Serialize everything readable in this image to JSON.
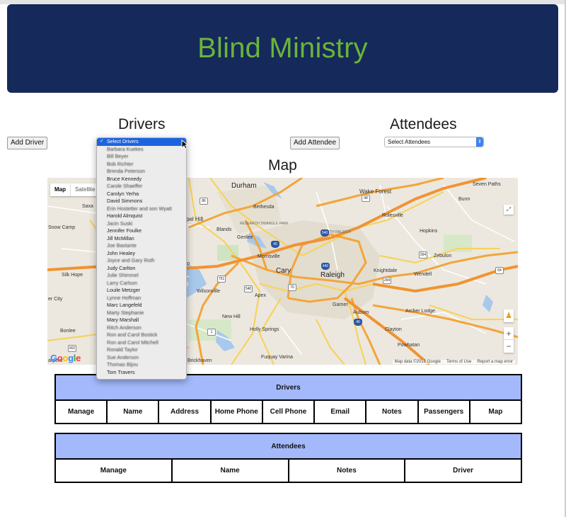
{
  "header": {
    "title": "Blind Ministry"
  },
  "drivers": {
    "heading": "Drivers",
    "add_button": "Add Driver",
    "select": {
      "selected": "Select Drivers",
      "options": [
        "Barbara Kuekes",
        "Bill Beyer",
        "Bob Richter",
        "Brenda Peterson",
        "Bruce Kennedy",
        "Carole Shaeffer",
        "Carolyn Yerha",
        "David Simmons",
        "Erin Hostetter and son Wyatt",
        "Harold Almquist",
        "Jacin Suski",
        "Jennifer Foulke",
        "Jill McMillan",
        "Joe Bastante",
        "John Healey",
        "Joyce and Gary Roth",
        "Judy Carlton",
        "Julie Shimmel",
        "Larry Carlson",
        "Louile Metzger",
        "Lynne Hoffman",
        "Marc Langefeld",
        "Marty Stephanie",
        "Mary Marshall",
        "Ritch Anderson",
        "Ron and Carol Bostick",
        "Ron and Carol Mitchell",
        "Ronald Taylor",
        "Sue Anderson",
        "Thomas Bijou",
        "Tom Travers"
      ]
    }
  },
  "attendees": {
    "heading": "Attendees",
    "add_button": "Add Attendee",
    "select": {
      "selected": "Select Attendees"
    }
  },
  "map": {
    "heading": "Map",
    "type_map": "Map",
    "type_satellite": "Satellite",
    "logo": "Google",
    "footer": {
      "data": "Map data ©2016 Google",
      "terms": "Terms of Use",
      "report": "Report a map error"
    },
    "zoom_in": "+",
    "zoom_out": "−",
    "places": {
      "durham": "Durham",
      "wake_forest": "Wake Forest",
      "seven_paths": "Seven Paths",
      "bunn": "Bunn",
      "bethesda": "Bethesda",
      "rolesville": "Rolesville",
      "snow_camp": "Snow Camp",
      "chapel_hill": "pel Hill",
      "blands": "Blands",
      "rtp": "RESEARCH TRIANGLE PARK",
      "north_raleigh": "NORTH RALEIGH",
      "hopkins": "Hopkins",
      "genlee": "Genlee",
      "morrisville": "Morrisville",
      "zebulon": "Zebulon",
      "cary": "Cary",
      "raleigh": "Raleigh",
      "knightdale": "Knightdale",
      "wendell": "Wendell",
      "silk_hope": "Silk Hope",
      "wilsonville": "Wilsonville",
      "apex": "Apex",
      "er_city": "er City",
      "archer_lodge": "Archer Lodge",
      "garner": "Garner",
      "new_hill": "New Hill",
      "auburn": "Auburn",
      "bonlee": "Bonlee",
      "holly_springs": "Holly Springs",
      "clayton": "Clayton",
      "powhatan": "Powhatan",
      "fuquay_varina": "Fuquay Varina",
      "brickhaven": "Brickhaven",
      "saxapahaw": "Saxa",
      "arpers": "arpers"
    }
  },
  "drivers_table": {
    "caption": "Drivers",
    "columns": [
      "Manage",
      "Name",
      "Address",
      "Home Phone",
      "Cell Phone",
      "Email",
      "Notes",
      "Passengers",
      "Map"
    ]
  },
  "attendees_table": {
    "caption": "Attendees",
    "columns": [
      "Manage",
      "Name",
      "Notes",
      "Driver"
    ]
  },
  "colors": {
    "header_bg": "#15295a",
    "title": "#6ab43a",
    "table_caption_bg": "#a4b9fc",
    "select_highlight": "#1c63e0"
  }
}
